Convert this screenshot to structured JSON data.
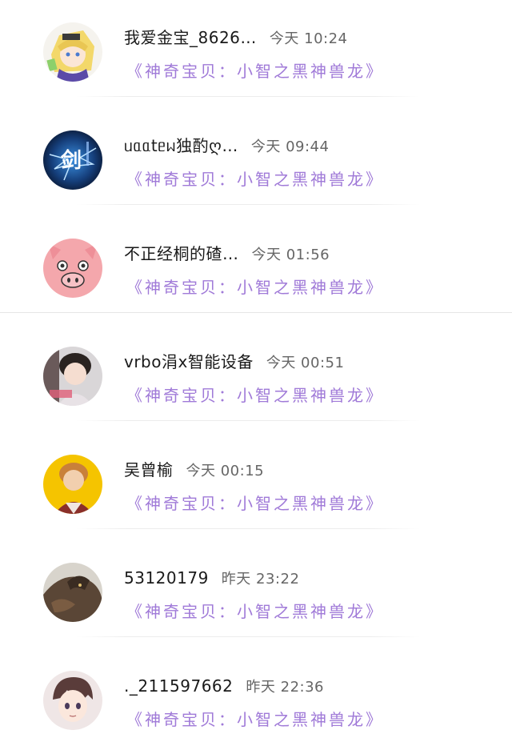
{
  "conversations": [
    {
      "name": "我爱金宝_8626…",
      "time": "今天 10:24",
      "message": "《神奇宝贝：小智之黑神兽龙》",
      "avatar": "anime-girl-avatar"
    },
    {
      "name": "ᥙᥲᥲtᥱᥕ独酌ღ…",
      "time": "今天 09:44",
      "message": "《神奇宝贝：小智之黑神兽龙》",
      "avatar": "blue-sword-avatar"
    },
    {
      "name": "不正经桐的碴…",
      "time": "今天 01:56",
      "message": "《神奇宝贝：小智之黑神兽龙》",
      "avatar": "pink-pig-avatar"
    },
    {
      "name": "vrbo涓x智能设备",
      "time": "今天 00:51",
      "message": "《神奇宝贝：小智之黑神兽龙》",
      "avatar": "young-man-avatar"
    },
    {
      "name": "吴曾榆",
      "time": "今天 00:15",
      "message": "《神奇宝贝：小智之黑神兽龙》",
      "avatar": "yellow-bg-person-avatar"
    },
    {
      "name": "53120179",
      "time": "昨天 23:22",
      "message": "《神奇宝贝：小智之黑神兽龙》",
      "avatar": "beast-avatar"
    },
    {
      "name": "._211597662",
      "time": "昨天 22:36",
      "message": "《神奇宝贝：小智之黑神兽龙》",
      "avatar": "anime-boy-avatar"
    }
  ]
}
